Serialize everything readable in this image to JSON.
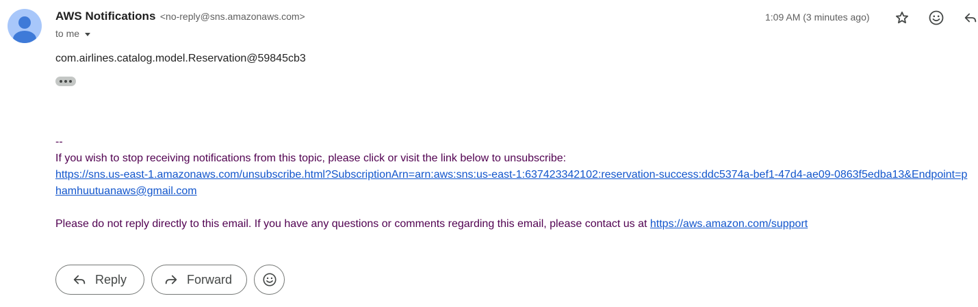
{
  "header": {
    "sender_name": "AWS Notifications",
    "sender_email": "<no-reply@sns.amazonaws.com>",
    "recipient_label": "to me",
    "timestamp": "1:09 AM (3 minutes ago)"
  },
  "icons": {
    "avatar": "person-avatar-icon",
    "recipient_caret": "caret-down-icon",
    "star": "star-icon",
    "emoji": "smiley-emoji-icon",
    "reply": "reply-arrow-icon",
    "forward": "forward-arrow-icon",
    "more": "ellipsis-icon"
  },
  "message": {
    "body": "com.airlines.catalog.model.Reservation@59845cb3",
    "signature_separator": "--",
    "unsubscribe_text": "If you wish to stop receiving notifications from this topic, please click or visit the link below to unsubscribe:",
    "unsubscribe_link": "https://sns.us-east-1.amazonaws.com/unsubscribe.html?SubscriptionArn=arn:aws:sns:us-east-1:637423342102:reservation-success:ddc5374a-bef1-47d4-ae09-0863f5edba13&Endpoint=phamhuutuanaws@gmail.com",
    "contact_text": "Please do not reply directly to this email. If you have any questions or comments regarding this email, please contact us at ",
    "contact_link": "https://aws.amazon.com/support"
  },
  "actions": {
    "reply_label": "Reply",
    "forward_label": "Forward"
  },
  "colors": {
    "avatar_bg": "#a8c7fa",
    "avatar_figure": "#3e7ad8",
    "footer_text": "#500050",
    "link": "#1155cc"
  }
}
